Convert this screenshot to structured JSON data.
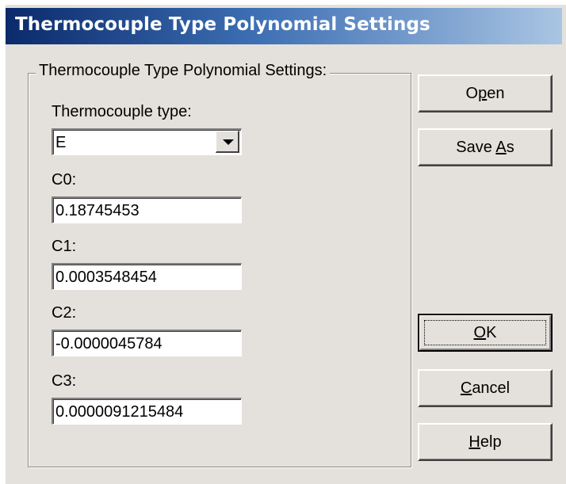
{
  "window": {
    "title": "Thermocouple Type Polynomial Settings"
  },
  "group": {
    "legend": "Thermocouple Type Polynomial Settings:"
  },
  "thermocouple": {
    "label": "Thermocouple type:",
    "selected": "E"
  },
  "coefficients": {
    "c0": {
      "label": "C0:",
      "value": "0.18745453"
    },
    "c1": {
      "label": "C1:",
      "value": "0.0003548454"
    },
    "c2": {
      "label": "C2:",
      "value": "-0.0000045784"
    },
    "c3": {
      "label": "C3:",
      "value": "0.0000091215484"
    }
  },
  "buttons": {
    "open": {
      "pre": "O",
      "mn": "p",
      "post": "en"
    },
    "save_as": {
      "pre": "Save ",
      "mn": "A",
      "post": "s"
    },
    "ok": {
      "pre": "",
      "mn": "O",
      "post": "K"
    },
    "cancel": {
      "pre": "",
      "mn": "C",
      "post": "ancel"
    },
    "help": {
      "pre": "",
      "mn": "H",
      "post": "elp"
    }
  }
}
